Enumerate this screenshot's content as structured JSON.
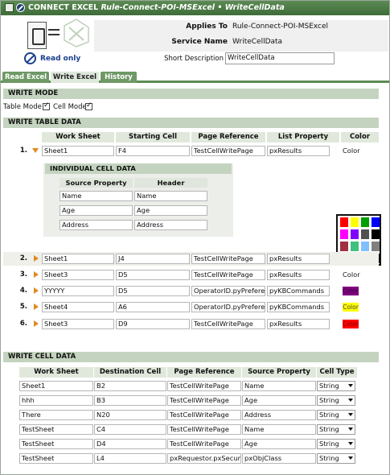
{
  "title": {
    "prefix": "CONNECT EXCEL",
    "rule": "Rule-Connect-POI-MSExcel",
    "sep": " • ",
    "name": "WriteCellData"
  },
  "header": {
    "applies_to_label": "Applies To",
    "applies_to_value": "Rule-Connect-POI-MSExcel",
    "service_name_label": "Service Name",
    "service_name_value": "WriteCellData",
    "read_only": "Read only",
    "short_description_label": "Short Description",
    "short_description_value": "WriteCellData"
  },
  "tabs": [
    {
      "label": "Read Excel"
    },
    {
      "label": "Write Excel"
    },
    {
      "label": "History"
    }
  ],
  "write_mode": {
    "title": "WRITE MODE",
    "table_mode": "Table Mode",
    "cell_mode": "Cell Mode"
  },
  "write_table": {
    "title": "WRITE TABLE DATA",
    "columns": [
      "Work Sheet",
      "Starting Cell",
      "Page Reference",
      "List Property",
      "Color"
    ],
    "rows": [
      {
        "num": "1.",
        "sheet": "Sheet1",
        "cell": "F4",
        "page": "TestCellWritePage",
        "list": "pxResults",
        "color": "Color"
      },
      {
        "num": "2.",
        "sheet": "Sheet1",
        "cell": "J4",
        "page": "TestCellWritePage",
        "list": "pxResults",
        "color": ""
      },
      {
        "num": "3.",
        "sheet": "Sheet3",
        "cell": "D5",
        "page": "TestCellWritePage",
        "list": "pxResults",
        "color": "Color"
      },
      {
        "num": "4.",
        "sheet": "YYYYY",
        "cell": "D5",
        "page": "OperatorID.pyPreference",
        "list": "pyKBCommands",
        "color": "Color"
      },
      {
        "num": "5.",
        "sheet": "Sheet4",
        "cell": "A6",
        "page": "OperatorID.pyPreference",
        "list": "pyKBCommands",
        "color": "Color"
      },
      {
        "num": "6.",
        "sheet": "Sheet3",
        "cell": "D9",
        "page": "TestCellWritePage",
        "list": "pxResults",
        "color": "Color"
      }
    ],
    "badge_colors": {
      "row4": "#800080",
      "row5": "#ffff00",
      "row6": "#ff0000"
    }
  },
  "individual": {
    "title": "INDIVIDUAL CELL DATA",
    "columns": [
      "Source Property",
      "Header"
    ],
    "rows": [
      {
        "prop": "Name",
        "header": "Name"
      },
      {
        "prop": "Age",
        "header": "Age"
      },
      {
        "prop": "Address",
        "header": "Address"
      }
    ]
  },
  "palette": [
    "#ff0000",
    "#ffff00",
    "#00a000",
    "#0000ff",
    "#ff00ff",
    "#8000ff",
    "#505050",
    "#000000",
    "#a03040",
    "#40c080",
    "#80c0ff",
    "#808080",
    "#008000",
    "#0080ff",
    "#ffffff",
    "#000000"
  ],
  "write_cell": {
    "title": "WRITE CELL DATA",
    "columns": [
      "Work Sheet",
      "Destination Cell",
      "Page Reference",
      "Source Property",
      "Cell Type"
    ],
    "rows": [
      {
        "sheet": "Sheet1",
        "cell": "B2",
        "page": "TestCellWritePage",
        "prop": "Name",
        "type": "String"
      },
      {
        "sheet": "hhh",
        "cell": "B3",
        "page": "TestCellWritePage",
        "prop": "Age",
        "type": "String"
      },
      {
        "sheet": "There",
        "cell": "N20",
        "page": "TestCellWritePage",
        "prop": "Address",
        "type": "String"
      },
      {
        "sheet": "TestSheet",
        "cell": "C4",
        "page": "TestCellWritePage",
        "prop": "Name",
        "type": "String"
      },
      {
        "sheet": "TestSheet",
        "cell": "D4",
        "page": "TestCellWritePage",
        "prop": "Age",
        "type": "String"
      },
      {
        "sheet": "TestSheet",
        "cell": "L4",
        "page": "pxRequestor.pxSecuritySr",
        "prop": "pxObjClass",
        "type": "String"
      }
    ]
  },
  "colors": {
    "accent": "#5c8a54",
    "section": "#c4d3bf",
    "link": "#1a3f8b"
  }
}
